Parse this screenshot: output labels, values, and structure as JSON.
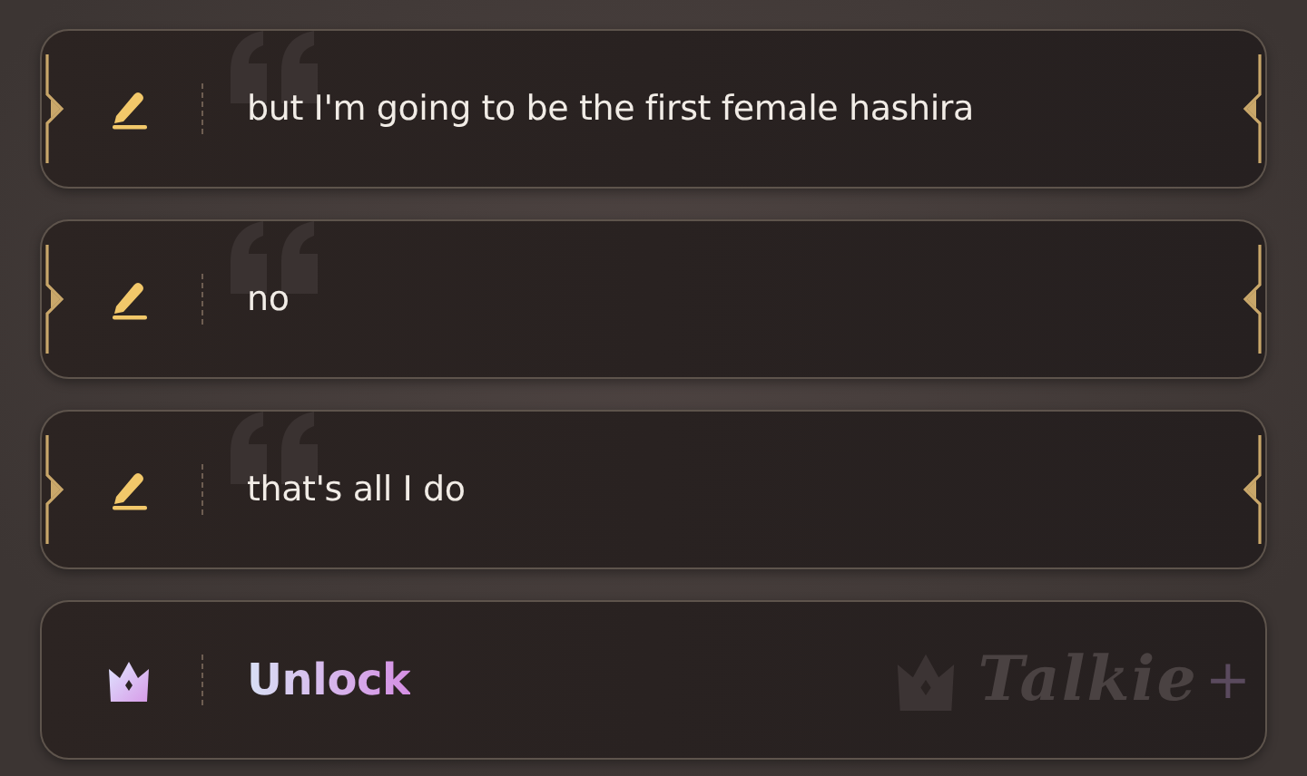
{
  "cards": [
    {
      "kind": "reply",
      "text": "but I'm going to be the first female hashira"
    },
    {
      "kind": "reply",
      "text": "no"
    },
    {
      "kind": "reply",
      "text": "that's all I do"
    },
    {
      "kind": "unlock",
      "text": "Unlock",
      "brand": "Talkie",
      "brand_mark": "+"
    }
  ]
}
